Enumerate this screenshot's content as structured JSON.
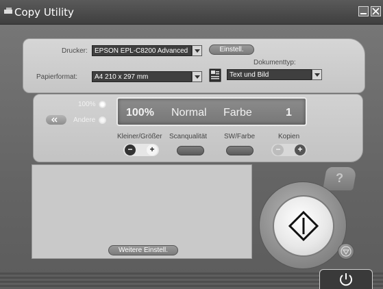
{
  "window": {
    "title": "Copy Utility",
    "icons": [
      "app-icon",
      "minimize-icon",
      "close-icon"
    ]
  },
  "settings": {
    "printer_label": "Drucker:",
    "printer_value": "EPSON EPL-C8200 Advanced",
    "setup_button": "Einstell.",
    "paper_label": "Papierformat:",
    "paper_value": "A4 210 x 297 mm",
    "doctype_label": "Dokumenttyp:",
    "doctype_value": "Text und Bild"
  },
  "copy": {
    "zoom_100_label": "100%",
    "zoom_other_label": "Andere",
    "display": {
      "zoom": "100%",
      "quality": "Normal",
      "color": "Farbe",
      "copies": "1"
    },
    "controls": {
      "size_label": "Kleiner/Größer",
      "quality_label": "Scanqualität",
      "color_label": "SW/Farbe",
      "copies_label": "Kopien",
      "minus": "−",
      "plus": "+"
    }
  },
  "preview": {
    "more_settings_button": "Weitere Einstell."
  },
  "actions": {
    "help": "?",
    "icons": [
      "start-icon",
      "stop-icon",
      "power-icon",
      "help-icon",
      "document-type-icon"
    ]
  },
  "colors": {
    "panel": "#cfcfcf",
    "display": "#808080",
    "background": "#666666"
  }
}
